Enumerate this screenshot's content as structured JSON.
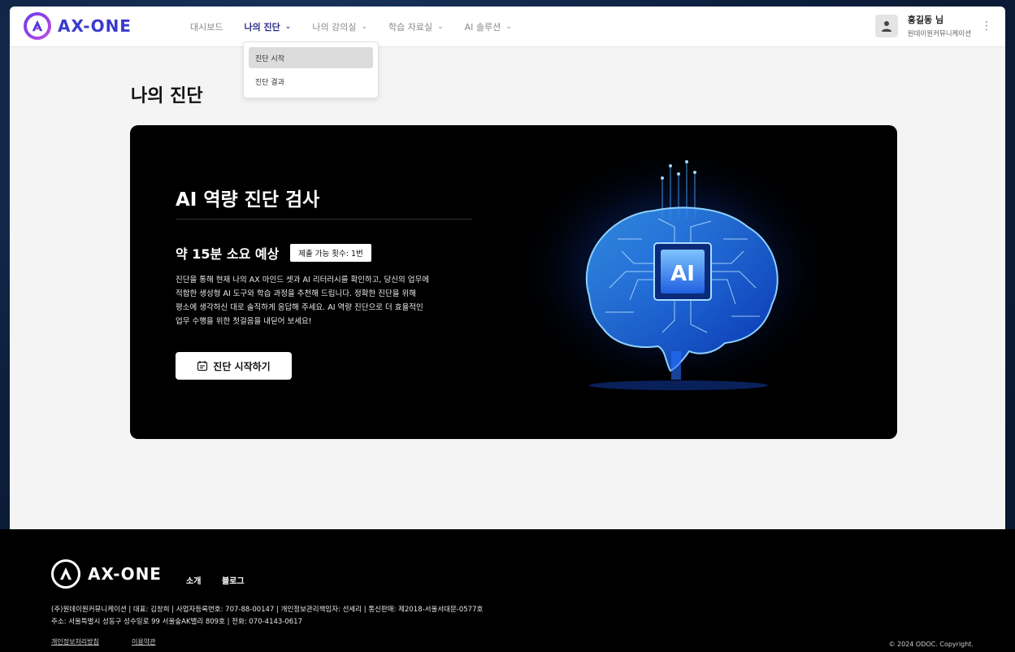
{
  "brand": {
    "name": "AX-ONE"
  },
  "nav": {
    "items": [
      {
        "label": "대시보드",
        "has_chevron": false,
        "active": false
      },
      {
        "label": "나의 진단",
        "has_chevron": true,
        "active": true
      },
      {
        "label": "나의 강의실",
        "has_chevron": true,
        "active": false
      },
      {
        "label": "학습 자료실",
        "has_chevron": true,
        "active": false
      },
      {
        "label": "AI 솔루션",
        "has_chevron": true,
        "active": false
      }
    ],
    "chevron": "⌄"
  },
  "user": {
    "name": "홍길동 님",
    "org": "원데이원커뮤니케이션",
    "menu_icon": "⋮"
  },
  "dropdown": {
    "items": [
      "진단 시작",
      "진단 결과"
    ],
    "hovered": "진단 시작"
  },
  "page": {
    "title": "나의 진단"
  },
  "hero": {
    "title": "AI 역량 진단 검사",
    "duration": "약 15분 소요 예상",
    "badge": "제출 가능 횟수: 1번",
    "desc_lines": [
      "진단을 통해 현재 나의 AX 마인드 셋과 AI 리터러시를 확인하고, 당신의 업무에",
      "적합한 생성형 AI 도구와 학습 과정을 추천해 드립니다. 정확한 진단을 위해",
      "평소에 생각하신 대로 솔직하게 응답해 주세요. AI 역량 진단으로 더 효율적인",
      "업무 수행을 위한 첫걸음을 내딛어 보세요!"
    ],
    "button": "진단 시작하기",
    "chip_label": "AI"
  },
  "footer": {
    "links": [
      "소개",
      "블로그"
    ],
    "info_lines": [
      "(주)원데이원커뮤니케이션 | 대표: 김창희 | 사업자등록번호: 707-88-00147 | 개인정보관리책임자: 선세리 | 통신판매: 제2018-서울서대문-0577호",
      "주소: 서울특별시 성동구 성수일로 99 서울숲AK밸리 809호 | 전화: 070-4143-0617"
    ],
    "policies": [
      "개인정보처리방침",
      "이용약관"
    ],
    "copyright": "© 2024 ODOC. Copyright."
  },
  "colors": {
    "accent": "#2a2a88",
    "brand_gradient_start": "#6a3de8",
    "brand_gradient_end": "#c24be0",
    "hero_bg": "#000000"
  }
}
